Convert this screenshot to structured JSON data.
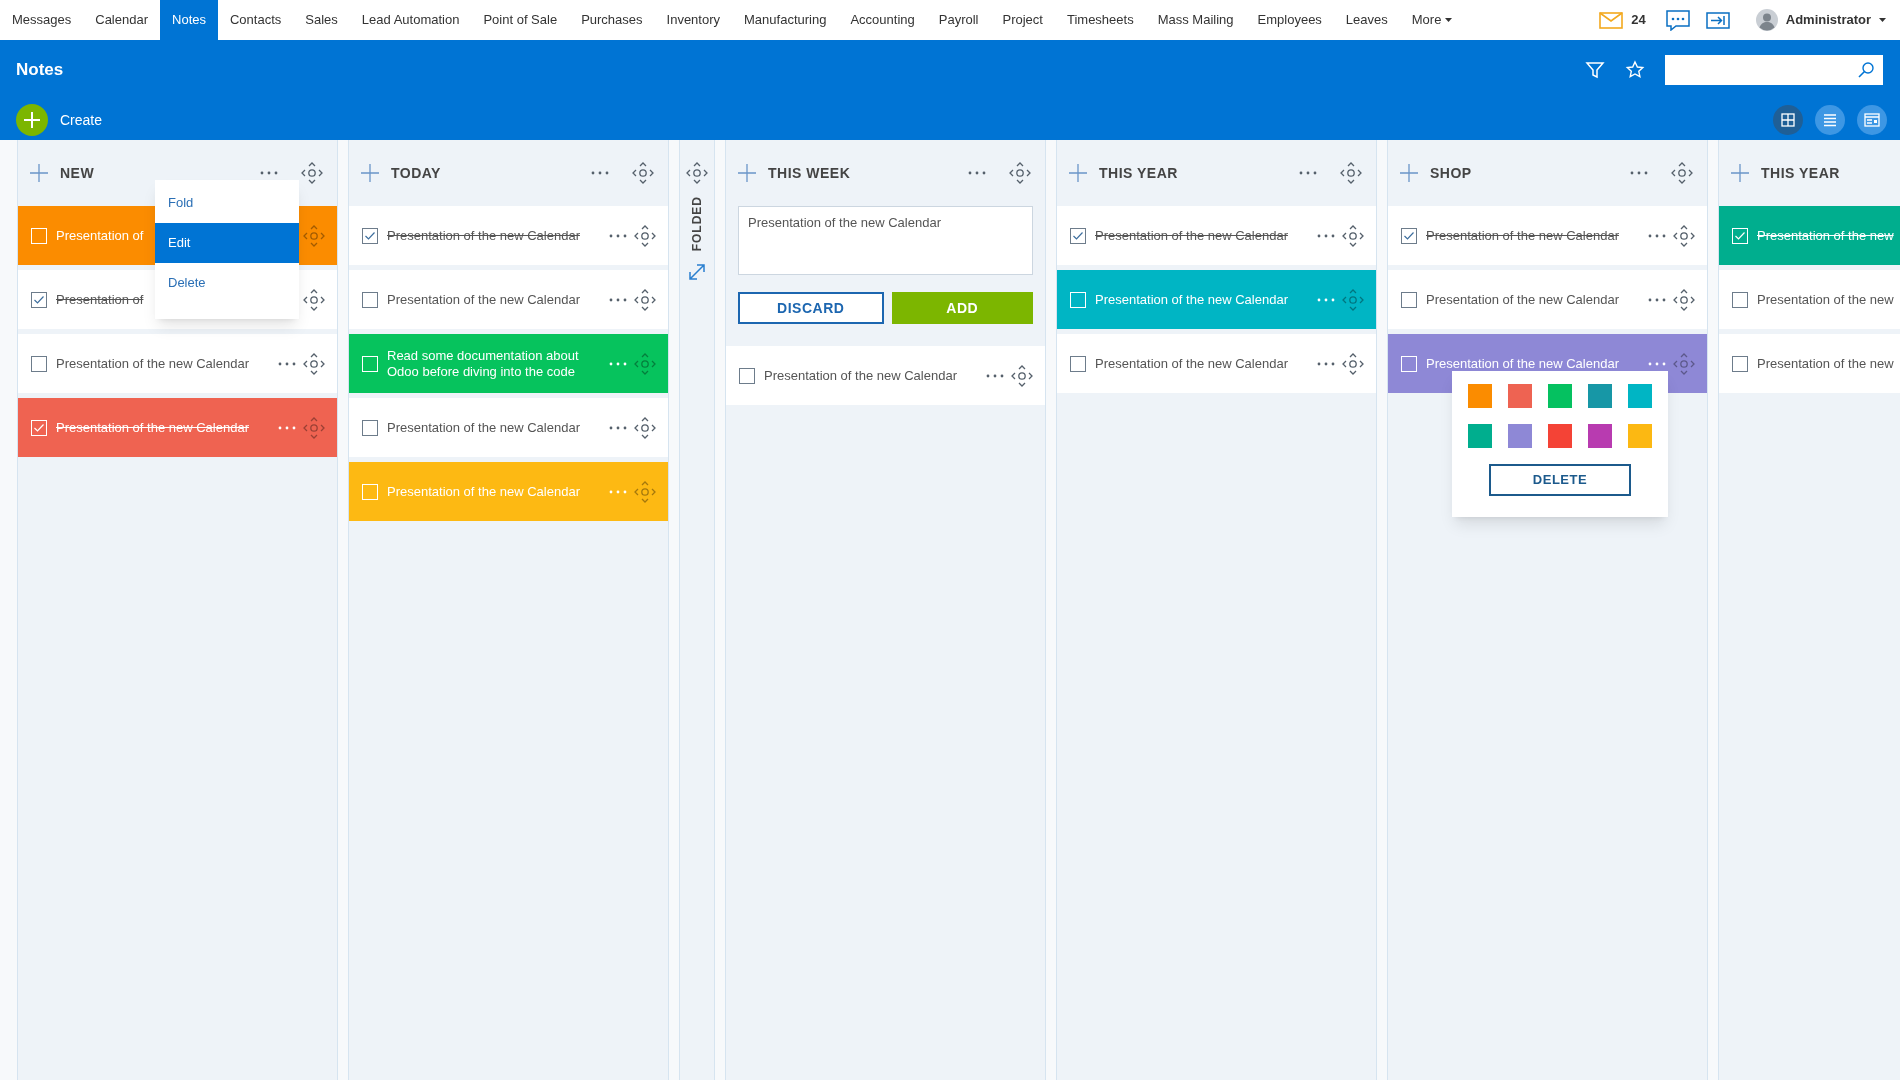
{
  "nav": {
    "items": [
      {
        "label": "Messages",
        "selected": false
      },
      {
        "label": "Calendar",
        "selected": false
      },
      {
        "label": "Notes",
        "selected": true
      },
      {
        "label": "Contacts",
        "selected": false
      },
      {
        "label": "Sales",
        "selected": false
      },
      {
        "label": "Lead Automation",
        "selected": false
      },
      {
        "label": "Point of Sale",
        "selected": false
      },
      {
        "label": "Purchases",
        "selected": false
      },
      {
        "label": "Inventory",
        "selected": false
      },
      {
        "label": "Manufacturing",
        "selected": false
      },
      {
        "label": "Accounting",
        "selected": false
      },
      {
        "label": "Payroll",
        "selected": false
      },
      {
        "label": "Project",
        "selected": false
      },
      {
        "label": "Timesheets",
        "selected": false
      },
      {
        "label": "Mass Mailing",
        "selected": false
      },
      {
        "label": "Employees",
        "selected": false
      },
      {
        "label": "Leaves",
        "selected": false
      }
    ],
    "more": "More",
    "mail_count": "24",
    "user": "Administrator"
  },
  "header": {
    "title": "Notes",
    "create": "Create",
    "views": [
      {
        "kind": "grid",
        "selected": true
      },
      {
        "kind": "list",
        "selected": false
      },
      {
        "kind": "card",
        "selected": false
      }
    ]
  },
  "columns": [
    {
      "kind": "stage",
      "title": "NEW",
      "cut_off": false,
      "menu": [
        {
          "label": "Fold",
          "selected": false
        },
        {
          "label": "Edit",
          "selected": true
        },
        {
          "label": "Delete",
          "selected": false
        }
      ],
      "cards": [
        {
          "text": "Presentation of",
          "done": false,
          "color": "#fb8c00"
        },
        {
          "text": "Presentation of",
          "done": true,
          "color": "#ffffff"
        },
        {
          "text": "Presentation of the new Calendar",
          "done": false,
          "color": "#ffffff"
        },
        {
          "text": "Presentation of the new Calendar",
          "done": true,
          "color": "#ef6351"
        }
      ]
    },
    {
      "kind": "stage",
      "title": "TODAY",
      "cut_off": false,
      "cards": [
        {
          "text": "Presentation of the new Calendar",
          "done": true,
          "color": "#ffffff"
        },
        {
          "text": "Presentation of the new Calendar",
          "done": false,
          "color": "#ffffff"
        },
        {
          "text": "Read some documentation about Odoo before diving into the code",
          "done": false,
          "color": "#06c35d"
        },
        {
          "text": "Presentation of the new Calendar",
          "done": false,
          "color": "#ffffff"
        },
        {
          "text": "Presentation of the new Calendar",
          "done": false,
          "color": "#fdb913"
        }
      ]
    },
    {
      "kind": "folded",
      "label": "FOLDED"
    },
    {
      "kind": "stage",
      "title": "THIS WEEK",
      "cut_off": false,
      "quick_create": {
        "value": "Presentation of the new Calendar",
        "discard": "DISCARD",
        "add": "ADD"
      },
      "cards": [
        {
          "text": "Presentation of the new Calendar",
          "done": false,
          "color": "#ffffff"
        }
      ]
    },
    {
      "kind": "stage",
      "title": "THIS YEAR",
      "cut_off": false,
      "cards": [
        {
          "text": "Presentation of the new Calendar",
          "done": true,
          "color": "#ffffff"
        },
        {
          "text": "Presentation of the new Calendar",
          "done": false,
          "color": "#00b5c4"
        },
        {
          "text": "Presentation of the new Calendar",
          "done": false,
          "color": "#ffffff"
        }
      ]
    },
    {
      "kind": "stage",
      "title": "SHOP",
      "cut_off": false,
      "color_picker": {
        "swatches": [
          {
            "color": "#fb8c00"
          },
          {
            "color": "#ee6352"
          },
          {
            "color": "#05c160"
          },
          {
            "color": "#1797a6"
          },
          {
            "color": "#00b5c4"
          },
          {
            "color": "#00ae8e"
          },
          {
            "color": "#8e88d6"
          },
          {
            "color": "#f44336"
          },
          {
            "color": "#b83bb0"
          },
          {
            "color": "#fcb812"
          }
        ],
        "delete": "DELETE"
      },
      "cards": [
        {
          "text": "Presentation of the new Calendar",
          "done": true,
          "color": "#ffffff"
        },
        {
          "text": "Presentation of the new Calendar",
          "done": false,
          "color": "#ffffff"
        },
        {
          "text": "Presentation of the new Calendar",
          "done": false,
          "color": "#8e88d6"
        }
      ]
    },
    {
      "kind": "stage",
      "title": "THIS YEAR",
      "cut_off": true,
      "cards": [
        {
          "text": "Presentation of the new",
          "done": true,
          "color": "#00ae8e"
        },
        {
          "text": "Presentation of the new",
          "done": false,
          "color": "#ffffff"
        },
        {
          "text": "Presentation of the new",
          "done": false,
          "color": "#ffffff"
        }
      ]
    }
  ]
}
